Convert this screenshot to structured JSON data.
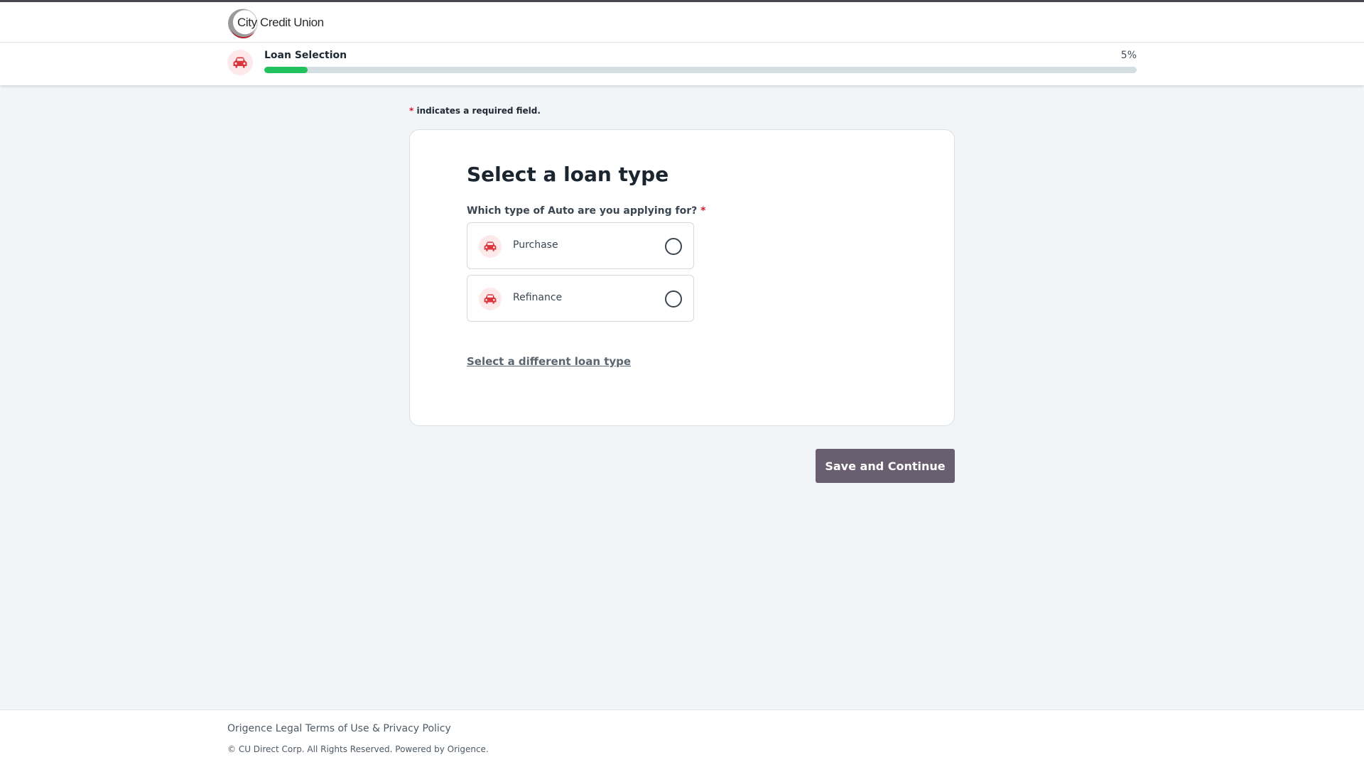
{
  "brand": {
    "name": "City Credit Union",
    "accent_color": "#21c25e",
    "logo_color": "#b5202e",
    "button_color": "#6a5f70"
  },
  "progress": {
    "step_label": "Loan Selection",
    "percent_text": "5%",
    "percent_value": 5,
    "icon": "car-icon"
  },
  "form": {
    "required_asterisk": "*",
    "required_note": "indicates a required field.",
    "title": "Select a loan type",
    "question": "Which type of Auto are you applying for?",
    "question_required": "*",
    "options": [
      {
        "label": "Purchase",
        "icon": "car-icon",
        "selected": false
      },
      {
        "label": "Refinance",
        "icon": "car-icon",
        "selected": false
      }
    ],
    "different_type_link": "Select a different loan type"
  },
  "actions": {
    "save_label": "Save and Continue"
  },
  "footer": {
    "legal_link": "Origence Legal",
    "terms_link": "Terms of Use & Privacy Policy",
    "copyright": "© CU Direct Corp. All Rights Reserved. Powered by Origence."
  }
}
